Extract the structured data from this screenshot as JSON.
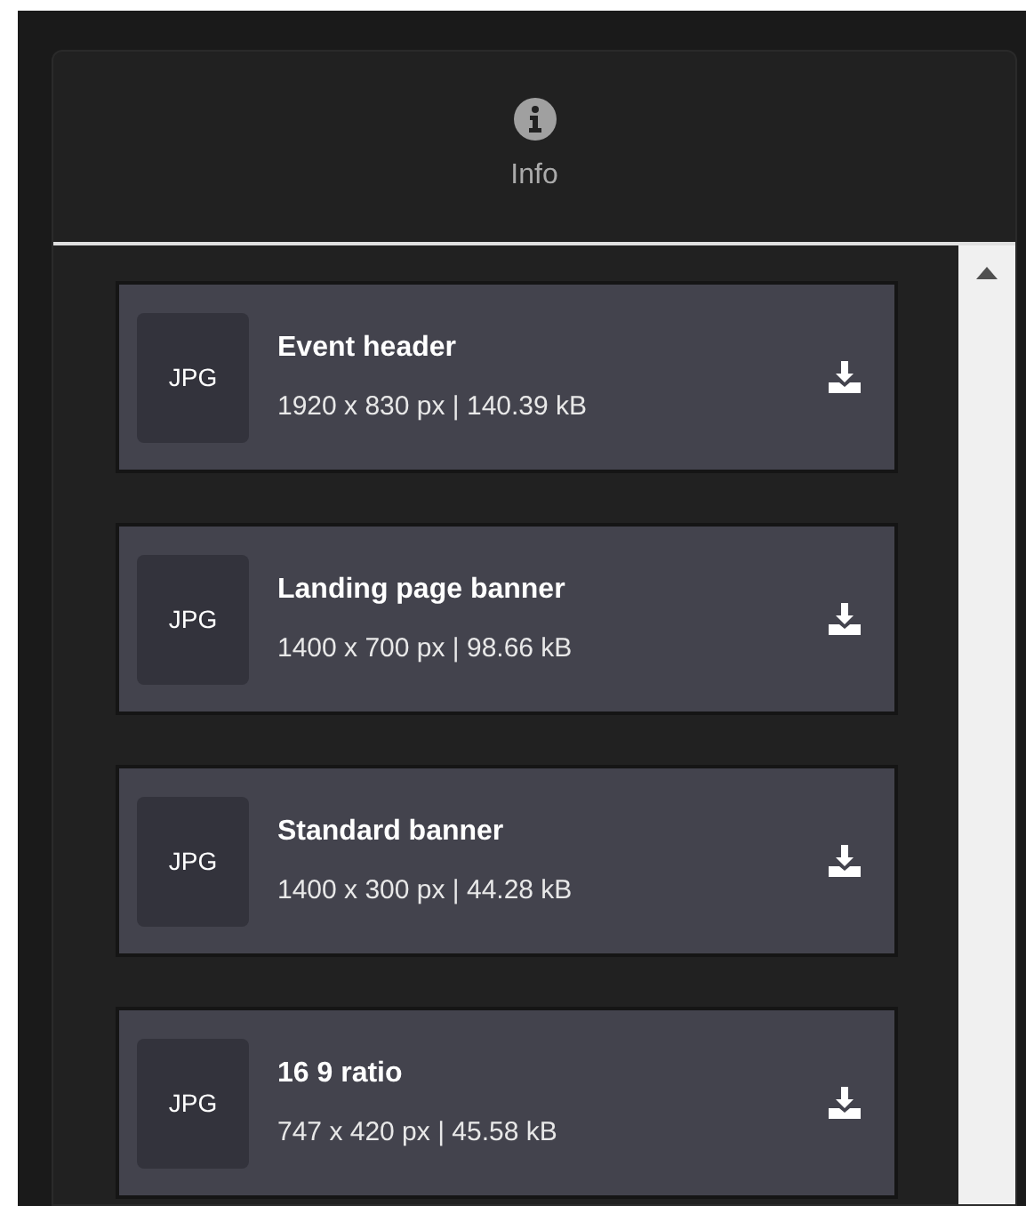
{
  "panel": {
    "tab": {
      "label": "Info"
    }
  },
  "files": [
    {
      "type": "JPG",
      "title": "Event header",
      "details": "1920 x 830 px | 140.39 kB"
    },
    {
      "type": "JPG",
      "title": "Landing page banner",
      "details": "1400 x 700 px | 98.66 kB"
    },
    {
      "type": "JPG",
      "title": "Standard banner",
      "details": "1400 x 300 px | 44.28 kB"
    },
    {
      "type": "JPG",
      "title": "16 9 ratio",
      "details": "747 x 420 px | 45.58 kB"
    }
  ]
}
